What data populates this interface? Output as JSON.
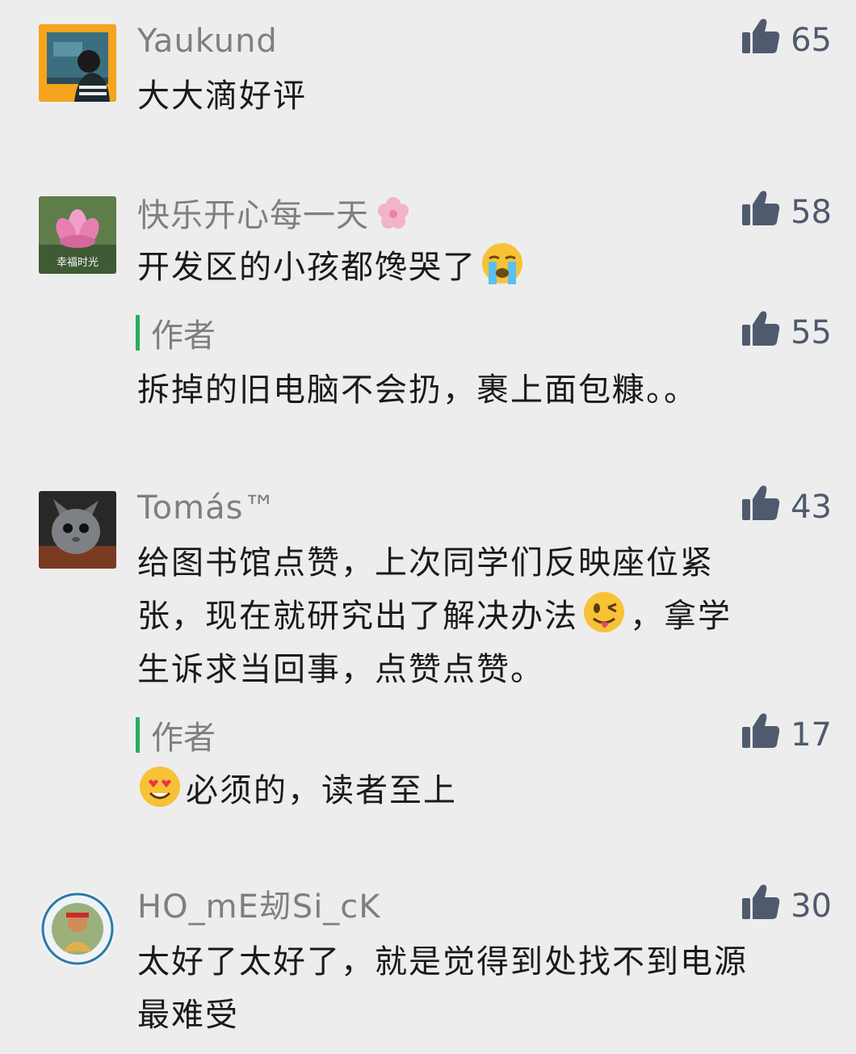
{
  "comments": [
    {
      "name": "Yaukund",
      "likes": "65",
      "text": "大大滴好评"
    },
    {
      "name": "快乐开心每一天",
      "likes": "58",
      "text": "开发区的小孩都馋哭了",
      "avatar_text": "幸福时光",
      "reply": {
        "label": "作者",
        "likes": "55",
        "text": "拆掉的旧电脑不会扔，裹上面包糠。。"
      }
    },
    {
      "name": "Tomás™",
      "likes": "43",
      "text_lines": [
        "给图书馆点赞，上次同学们反映座位紧",
        "张，现在就研究出了解决办法",
        "，拿学",
        "生诉求当回事，点赞点赞。"
      ],
      "reply": {
        "label": "作者",
        "likes": "17",
        "text": "必须的，读者至上"
      }
    },
    {
      "name": "HO_mE刼Si_cK",
      "likes": "30",
      "text_lines": [
        "太好了太好了，就是觉得到处找不到电源",
        "最难受"
      ]
    }
  ],
  "icons": {
    "like": "thumbs-up-icon",
    "crying": "crying-face-emoji",
    "wink_tongue": "winking-tongue-emoji",
    "heart_eyes": "heart-eyes-emoji",
    "flower": "cherry-blossom-icon"
  },
  "colors": {
    "background": "#ededed",
    "name": "#7f7f7f",
    "text": "#1a1a1a",
    "like": "#505a6e",
    "reply_bar": "#27ae60"
  }
}
